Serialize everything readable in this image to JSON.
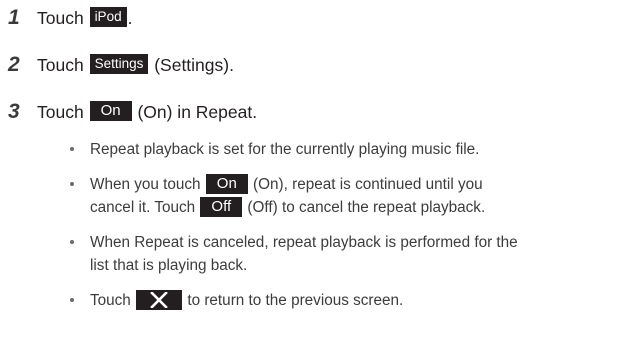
{
  "steps": [
    {
      "number": "1",
      "prefix": "Touch ",
      "key": "iPod",
      "suffix": "."
    },
    {
      "number": "2",
      "prefix": "Touch ",
      "key": "Settings",
      "suffix": " (Settings)."
    },
    {
      "number": "3",
      "prefix": "Touch ",
      "key": "On",
      "suffix": " (On) in Repeat."
    }
  ],
  "bullets": {
    "b1": {
      "text": "Repeat playback is set for the currently playing music file."
    },
    "b2": {
      "part1": "When you touch ",
      "key1": "On",
      "part2": " (On), repeat is continued until you",
      "part3": "cancel it. Touch ",
      "key2": "Off",
      "part4": " (Off) to cancel the repeat playback."
    },
    "b3": {
      "line1": "When Repeat is canceled, repeat playback is performed for the",
      "line2": "list that is playing back."
    },
    "b4": {
      "part1": "Touch ",
      "icon": "close-x-icon",
      "part2": " to return to the previous screen."
    }
  }
}
